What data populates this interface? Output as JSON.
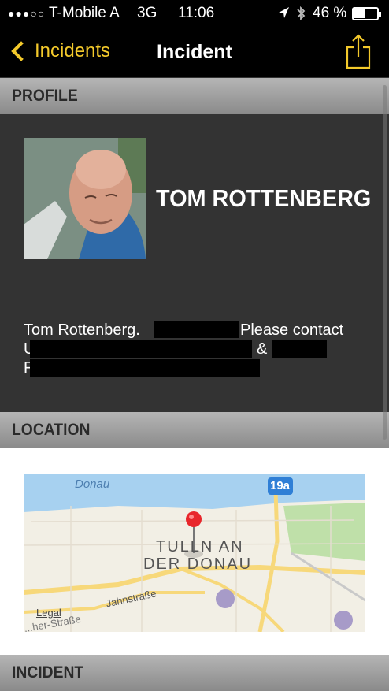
{
  "status_bar": {
    "signal_dots": "●●●○○",
    "carrier": "T-Mobile A",
    "network": "3G",
    "time": "11:06",
    "battery_percent": "46 %"
  },
  "nav": {
    "back_label": "Incidents",
    "title": "Incident",
    "accent_color": "#f3c92b"
  },
  "sections": {
    "profile": "PROFILE",
    "location": "LOCATION",
    "incident": "INCIDENT"
  },
  "profile": {
    "name": "TOM ROTTENBERG",
    "note_part1": "Tom Rottenberg.",
    "note_part2": "Please contact",
    "note_line2_start": "U",
    "note_amp": "&",
    "note_line3_start": "F"
  },
  "map": {
    "water_label": "Donau",
    "route_badge": "19a",
    "town_line1": "TULLN AN",
    "town_line2": "DER DONAU",
    "street1": "Jahnstraße",
    "street2": "...her-Straße",
    "legal": "Legal",
    "colors": {
      "water": "#a7d1f0",
      "park": "#bfe0a9",
      "road": "#f7d87a",
      "land": "#f2efe5",
      "pin": "#e8262b"
    }
  }
}
